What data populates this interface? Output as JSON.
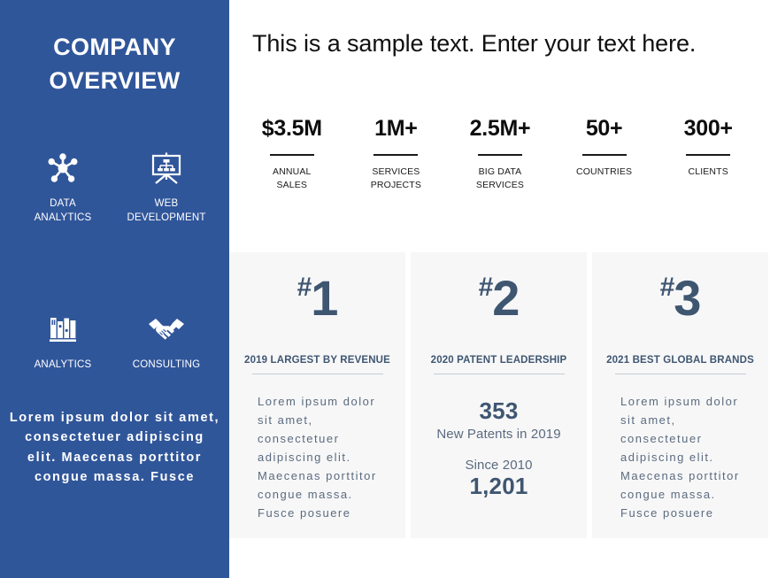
{
  "theme": {
    "sidebar_bg": "#30569a",
    "card_bg": "#f7f7f8",
    "accent_slate": "#3f5671",
    "body_text": "#5b6b7e"
  },
  "sidebar": {
    "title_line1": "COMPANY",
    "title_line2": "OVERVIEW",
    "icons": [
      {
        "icon": "network-hub-icon",
        "label_line1": "DATA",
        "label_line2": "ANALYTICS"
      },
      {
        "icon": "presentation-board-icon",
        "label_line1": "WEB",
        "label_line2": "DEVELOPMENT"
      },
      {
        "icon": "books-shelf-icon",
        "label_line1": "ANALYTICS",
        "label_line2": ""
      },
      {
        "icon": "handshake-icon",
        "label_line1": "CONSULTING",
        "label_line2": ""
      }
    ],
    "body_text": "Lorem ipsum dolor sit amet, consectetuer adipiscing elit. Maecenas porttitor congue massa. Fusce"
  },
  "main": {
    "headline": "This is a sample text. Enter your text here.",
    "stats": [
      {
        "value": "$3.5M",
        "label_line1": "ANNUAL",
        "label_line2": "SALES"
      },
      {
        "value": "1M+",
        "label_line1": "SERVICES",
        "label_line2": "PROJECTS"
      },
      {
        "value": "2.5M+",
        "label_line1": "BIG DATA",
        "label_line2": "SERVICES"
      },
      {
        "value": "50+",
        "label_line1": "COUNTRIES",
        "label_line2": ""
      },
      {
        "value": "300+",
        "label_line1": "CLIENTS",
        "label_line2": ""
      }
    ],
    "cards": [
      {
        "hash": "#",
        "rank": "1",
        "title": "2019 LARGEST BY REVENUE",
        "body": "Lorem ipsum dolor sit amet, consectetuer adipiscing elit. Maecenas porttitor congue massa. Fusce posuere",
        "stat_primary_number": "",
        "stat_primary_caption": "",
        "stat_secondary_caption": "",
        "stat_secondary_number": ""
      },
      {
        "hash": "#",
        "rank": "2",
        "title": "2020 PATENT LEADERSHIP",
        "body": "",
        "stat_primary_number": "353",
        "stat_primary_caption": "New Patents in 2019",
        "stat_secondary_caption": "Since 2010",
        "stat_secondary_number": "1,201"
      },
      {
        "hash": "#",
        "rank": "3",
        "title": "2021 BEST GLOBAL BRANDS",
        "body": "Lorem ipsum dolor sit amet, consectetuer adipiscing elit. Maecenas porttitor congue massa. Fusce posuere",
        "stat_primary_number": "",
        "stat_primary_caption": "",
        "stat_secondary_caption": "",
        "stat_secondary_number": ""
      }
    ]
  }
}
